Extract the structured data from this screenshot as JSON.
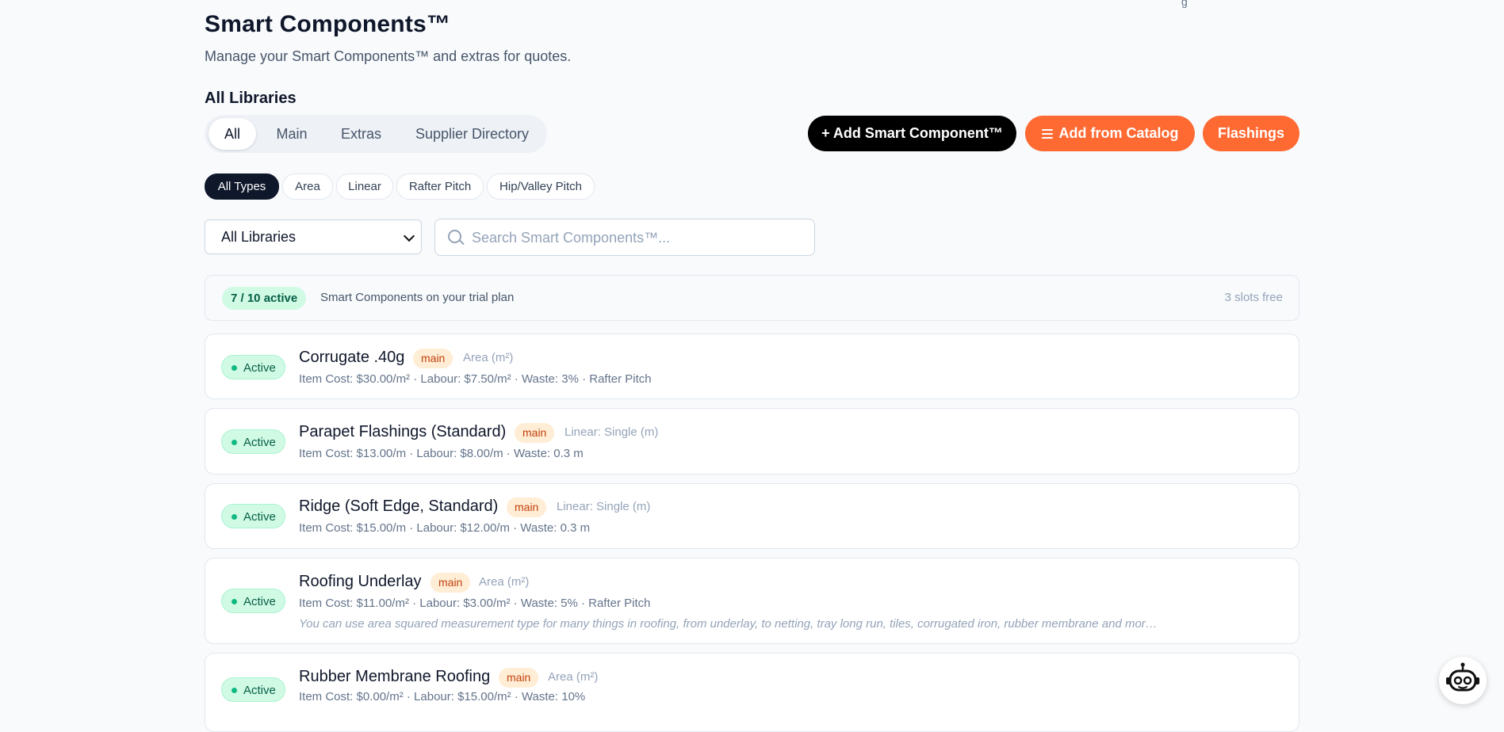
{
  "header": {
    "title": "Smart Components™",
    "subtitle": "Manage your Smart Components™ and extras for quotes.",
    "corner_text": "g"
  },
  "libraries": {
    "title": "All Libraries",
    "tabs": [
      {
        "label": "All",
        "active": true
      },
      {
        "label": "Main",
        "active": false
      },
      {
        "label": "Extras",
        "active": false
      },
      {
        "label": "Supplier Directory",
        "active": false
      }
    ]
  },
  "actions": {
    "add_component": "+ Add Smart Component™",
    "add_catalog": "Add from Catalog",
    "flashings": "Flashings"
  },
  "type_filters": [
    {
      "label": "All Types",
      "active": true
    },
    {
      "label": "Area",
      "active": false
    },
    {
      "label": "Linear",
      "active": false
    },
    {
      "label": "Rafter Pitch",
      "active": false
    },
    {
      "label": "Hip/Valley Pitch",
      "active": false
    }
  ],
  "filters": {
    "library_select": "All Libraries",
    "search_placeholder": "Search Smart Components™..."
  },
  "plan": {
    "badge": "7 / 10 active",
    "text": "Smart Components on your trial plan",
    "free": "3 slots free"
  },
  "components": [
    {
      "status": "Active",
      "name": "Corrugate .40g",
      "tag": "main",
      "type": "Area (m²)",
      "meta": "Item Cost: $30.00/m² · Labour: $7.50/m² · Waste: 3% · Rafter Pitch",
      "description": ""
    },
    {
      "status": "Active",
      "name": "Parapet Flashings (Standard)",
      "tag": "main",
      "type": "Linear: Single (m)",
      "meta": "Item Cost: $13.00/m · Labour: $8.00/m · Waste: 0.3 m",
      "description": ""
    },
    {
      "status": "Active",
      "name": "Ridge (Soft Edge, Standard)",
      "tag": "main",
      "type": "Linear: Single (m)",
      "meta": "Item Cost: $15.00/m · Labour: $12.00/m · Waste: 0.3 m",
      "description": ""
    },
    {
      "status": "Active",
      "name": "Roofing Underlay",
      "tag": "main",
      "type": "Area (m²)",
      "meta": "Item Cost: $11.00/m² · Labour: $3.00/m² · Waste: 5% · Rafter Pitch",
      "description": "You can use area squared measurement type for many things in roofing, from underlay, to netting, tray long run, tiles, corrugated iron, rubber membrane and mor…"
    },
    {
      "status": "Active",
      "name": "Rubber Membrane Roofing",
      "tag": "main",
      "type": "Area (m²)",
      "meta": "Item Cost: $0.00/m² · Labour: $15.00/m² · Waste: 10%",
      "description": ""
    }
  ],
  "colors": {
    "accent_orange": "#ff6a33",
    "active_green": "#10b981",
    "tag_orange": "#c2410c"
  },
  "assistant": {
    "icon": "robot-icon"
  }
}
